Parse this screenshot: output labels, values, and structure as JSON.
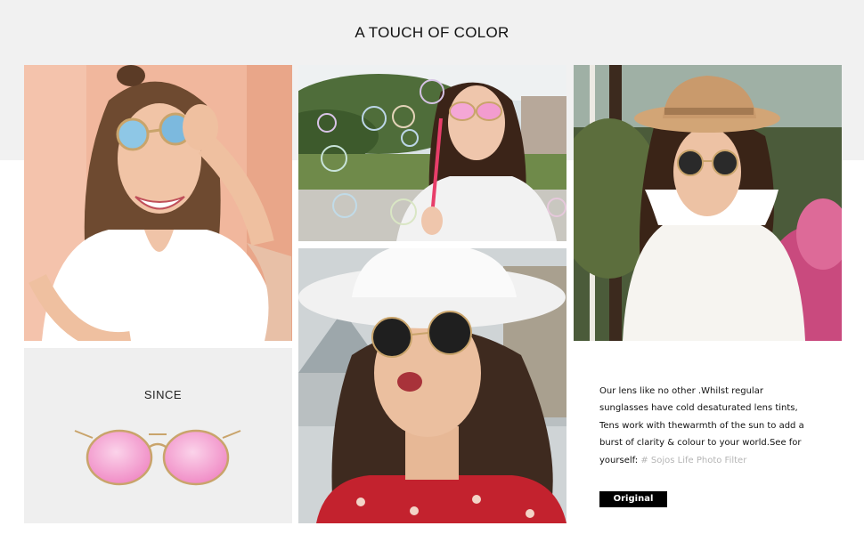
{
  "header": {
    "title": "A TOUCH OF COLOR"
  },
  "product": {
    "label": "SINCE"
  },
  "description": {
    "lines": [
      "Our lens like no other .Whilst regular",
      "sunglasses have cold desaturated lens tints,",
      "Tens work with thewarmth of the sun to add a",
      "burst of clarity & colour to your world.See for",
      "yourself: "
    ],
    "tag": "# Sojos Life Photo Filter"
  },
  "badge": {
    "label": "Original"
  },
  "colors": {
    "band": "#f1f1f1",
    "card": "#efefef",
    "lens_pink": "#f4a7d6",
    "frame_gold": "#c9a46b",
    "badge_bg": "#000000",
    "tag_gray": "#b5b5b5"
  },
  "images": [
    {
      "name": "model-blue-lens-peach-wall"
    },
    {
      "name": "model-pink-lens-bubbles"
    },
    {
      "name": "model-tan-hat-black-lens"
    },
    {
      "name": "model-white-hat-black-lens"
    },
    {
      "name": "pink-lens-gold-frame-sunglasses"
    }
  ]
}
